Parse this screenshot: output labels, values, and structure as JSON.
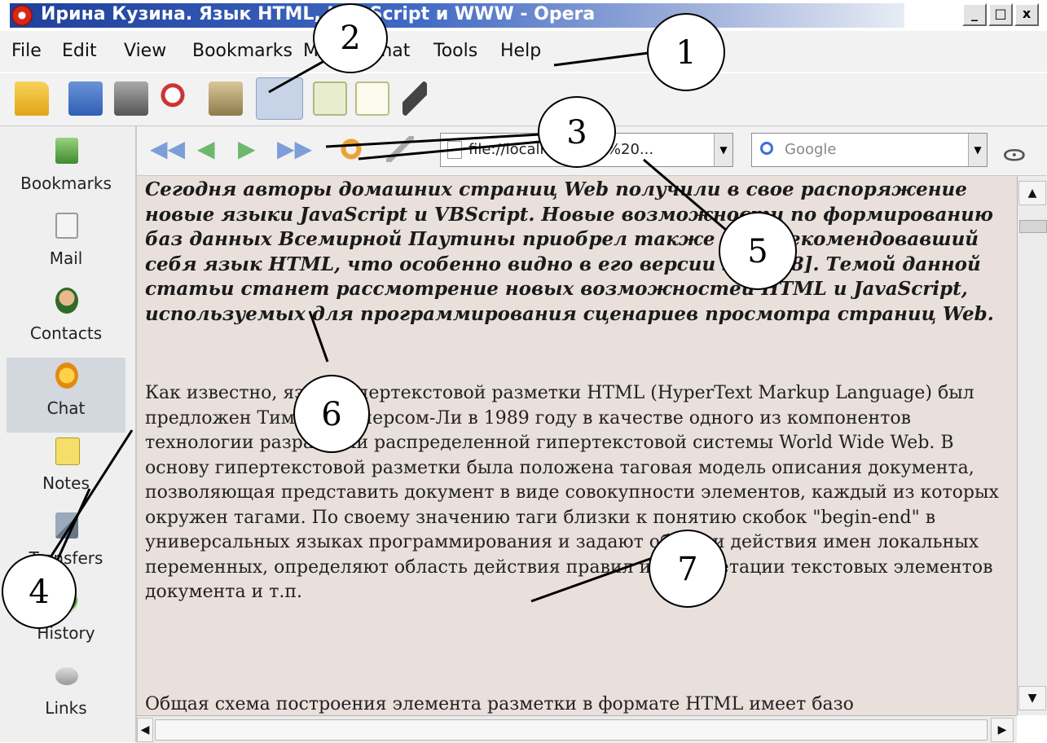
{
  "window": {
    "title": "Ирина Кузина. Язык HTML, JavaScript и WWW - Opera",
    "controls": [
      "_",
      "□",
      "x"
    ]
  },
  "menu": [
    "File",
    "Edit",
    "View",
    "Bookmarks",
    "Mail",
    "Chat",
    "Tools",
    "Help"
  ],
  "toolbar_icons": [
    "open-folder-icon",
    "save-icon",
    "print-icon",
    "find-icon",
    "home-icon",
    "panels-icon",
    "tile-icon",
    "cascade-icon",
    "customize-icon"
  ],
  "nav": {
    "icons": [
      "rewind-icon",
      "back-icon",
      "forward-icon",
      "fast-forward-icon",
      "reload-icon",
      "edit-icon"
    ],
    "address": "file://localhost/D:/1%20...",
    "search_placeholder": "Google"
  },
  "sidebar": [
    {
      "label": "Bookmarks",
      "icon": "bookmarks-icon"
    },
    {
      "label": "Mail",
      "icon": "mail-icon"
    },
    {
      "label": "Contacts",
      "icon": "contacts-icon"
    },
    {
      "label": "Chat",
      "icon": "chat-icon"
    },
    {
      "label": "Notes",
      "icon": "notes-icon"
    },
    {
      "label": "Transfers",
      "icon": "transfers-icon"
    },
    {
      "label": "History",
      "icon": "history-icon"
    },
    {
      "label": "Links",
      "icon": "links-icon"
    }
  ],
  "content": {
    "bold_paragraph": "Сегодня авторы домашних страниц Web получили в свое распоряжение новые языки JavaScript и VBScript. Новые возможности по формированию баз данных Всемирной Паутины приобрел также уже рекомендовавший себя язык HTML, что особенно видно в его версии 3.2 [1-8]. Темой данной статьи станет рассмотрение новых возможностей HTML и JavaScript, используемых для программирования сценариев просмотра страниц Web.",
    "body_paragraph": "Как известно, язык гипертекстовой разметки HTML (HyperText Markup Language) был предложен Тимом Бернерсом-Ли в 1989 году в качестве одного из компонентов технологии разработки распределенной гипертекстовой системы World Wide Web. В основу гипертекстовой разметки была положена таговая модель описания документа, позволяющая представить документ в виде совокупности элементов, каждый из которых окружен тагами. По своему значению таги близки к понятию скобок \"begin-end\" в универсальных языках программирования и задают области действия имен локальных переменных, определяют область действия правил интерпретации текстовых элементов документа и т.п.",
    "next_paragraph": "Общая схема построения элемента разметки в формате HTML имеет базо"
  },
  "callouts": [
    "1",
    "2",
    "3",
    "4",
    "5",
    "6",
    "7"
  ]
}
